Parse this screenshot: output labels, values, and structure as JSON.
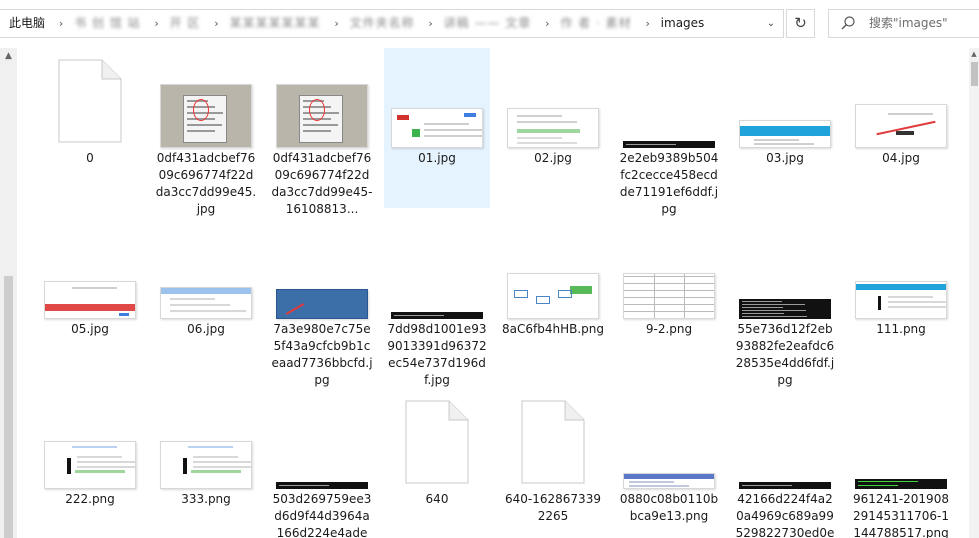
{
  "address_bar": {
    "root": "此电脑",
    "hidden_segments": [
      "书 创 馆 站",
      "开 区",
      "某某某某某某某",
      "文件夹名称",
      "讲稿 —— 文章",
      "作 者 · 素材"
    ],
    "current": "images"
  },
  "search": {
    "placeholder": "搜索\"images\""
  },
  "files": [
    {
      "name": "0",
      "kind": "blank"
    },
    {
      "name": "0df431adcbef7609c696774f22dda3cc7dd99e45.jpg",
      "kind": "dialog"
    },
    {
      "name": "0df431adcbef7609c696774f22dda3cc7dd99e45-16108813...",
      "kind": "dialog"
    },
    {
      "name": "01.jpg",
      "kind": "web-login",
      "selected": true
    },
    {
      "name": "02.jpg",
      "kind": "web-green"
    },
    {
      "name": "2e2eb9389b504fc2cecce458ecdde71191ef6ddf.jpg",
      "kind": "terminal-strip"
    },
    {
      "name": "03.jpg",
      "kind": "web-blue"
    },
    {
      "name": "04.jpg",
      "kind": "web-red"
    },
    {
      "name": "05.jpg",
      "kind": "web-redbar"
    },
    {
      "name": "06.jpg",
      "kind": "web-form"
    },
    {
      "name": "7a3e980e7c75e5f43a9cfcb9b1ceaad7736bbcfd.jpg",
      "kind": "blue-desktop"
    },
    {
      "name": "7dd98d1001e939013391d96372ec54e737d196df.jpg",
      "kind": "terminal-strip"
    },
    {
      "name": "8aC6fb4hHB.png",
      "kind": "diagram"
    },
    {
      "name": "9-2.png",
      "kind": "table"
    },
    {
      "name": "55e736d12f2eb93882fe2eafdc628535e4dd6fdf.jpg",
      "kind": "terminal"
    },
    {
      "name": "111.png",
      "kind": "web-blue-dark"
    },
    {
      "name": "222.png",
      "kind": "web-dark-green"
    },
    {
      "name": "333.png",
      "kind": "web-dark-green"
    },
    {
      "name": "503d269759ee3d6d9f44d3964a166d224e4ade",
      "kind": "terminal-strip"
    },
    {
      "name": "640",
      "kind": "blank"
    },
    {
      "name": "640-1628673392265",
      "kind": "blank"
    },
    {
      "name": "0880c08b0110bbca9e13.png",
      "kind": "excel"
    },
    {
      "name": "42166d224f4a20a4969c689a99529822730ed0e",
      "kind": "terminal-strip"
    },
    {
      "name": "961241-20190829145311706-1144788517.png",
      "kind": "terminal-green"
    }
  ],
  "colors": {
    "selection": "#e5f3ff",
    "border": "#d9d9d9"
  },
  "icons": {
    "refresh": "refresh-icon",
    "search": "search-icon",
    "dropdown": "chevron-down-icon"
  }
}
